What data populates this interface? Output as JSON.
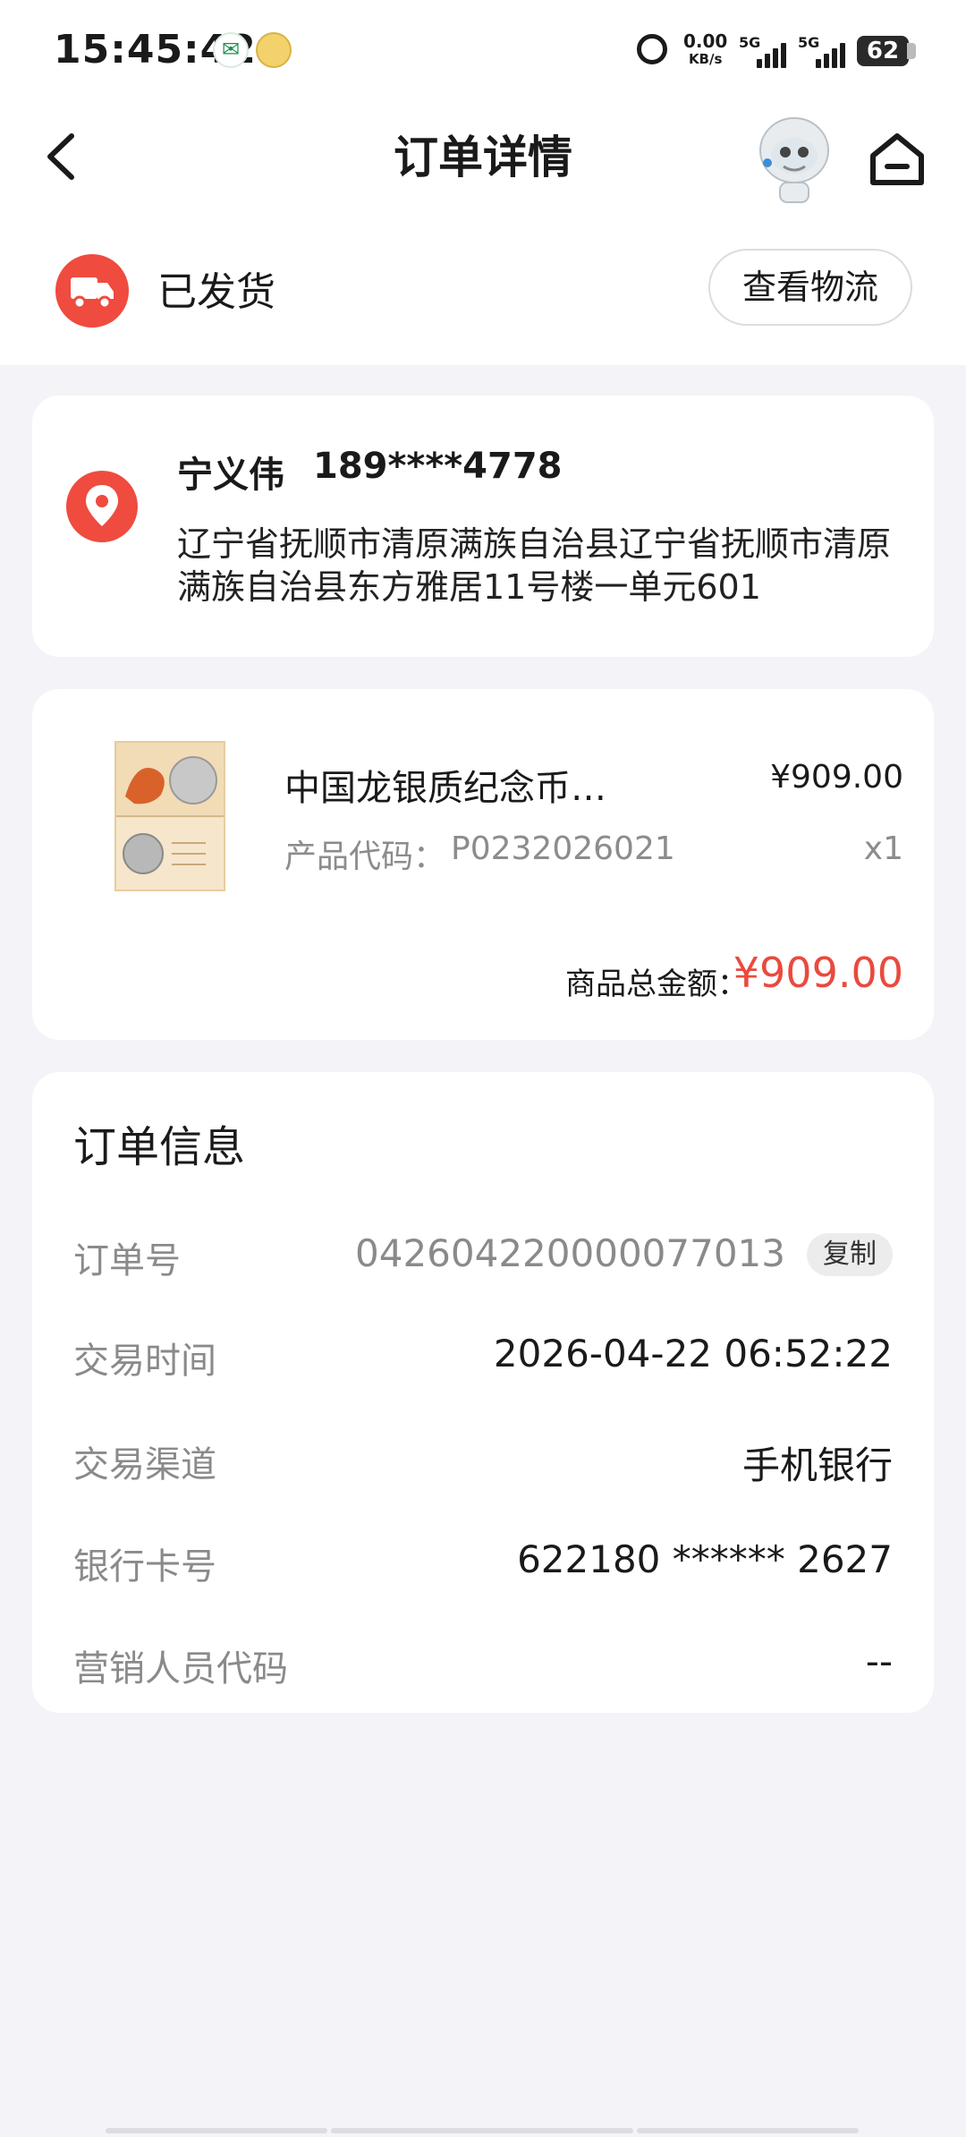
{
  "status_bar": {
    "time": "15:45:42",
    "net_speed": "0.00",
    "net_unit": "KB/s",
    "sim1": "5G",
    "sim2": "5G",
    "battery": "62"
  },
  "header": {
    "title": "订单详情"
  },
  "shipping": {
    "status": "已发货",
    "logistics_button": "查看物流"
  },
  "address": {
    "name": "宁义伟",
    "phone": "189****4778",
    "detail": "辽宁省抚顺市清原满族自治县辽宁省抚顺市清原满族自治县东方雅居11号楼一单元601"
  },
  "product": {
    "name": "中国龙银质纪念币…",
    "price": "¥909.00",
    "code_label": "产品代码：",
    "code": "P0232026021",
    "quantity": "x1",
    "total_label": "商品总金额：",
    "total_value": "¥909.00"
  },
  "order_info": {
    "title": "订单信息",
    "order_no_label": "订单号",
    "order_no": "042604220000077013",
    "copy_button": "复制",
    "time_label": "交易时间",
    "time": "2026-04-22 06:52:22",
    "channel_label": "交易渠道",
    "channel": "手机银行",
    "card_label": "银行卡号",
    "card": "622180 ****** 2627",
    "staff_label": "营销人员代码",
    "staff": "--"
  },
  "colors": {
    "accent": "#ea4a3e",
    "background": "#f3f3f8"
  }
}
